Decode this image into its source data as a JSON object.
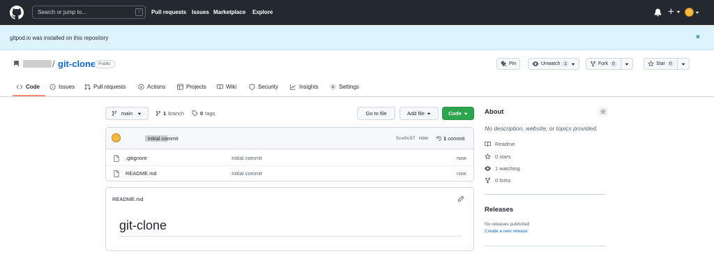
{
  "header": {
    "search_placeholder": "Search or jump to...",
    "search_key": "/",
    "nav": [
      "Pull requests",
      "Issues",
      "Marketplace",
      "Explore"
    ]
  },
  "banner": {
    "text": "gitpod.io was installed on this repository",
    "close": "×"
  },
  "repo": {
    "separator": "/",
    "name": "git-clone",
    "visibility": "Public",
    "pin_label": "Pin",
    "unwatch_label": "Unwatch",
    "unwatch_count": "1",
    "fork_label": "Fork",
    "fork_count": "0",
    "star_label": "Star",
    "star_count": "0"
  },
  "tabs": [
    "Code",
    "Issues",
    "Pull requests",
    "Actions",
    "Projects",
    "Wiki",
    "Security",
    "Insights",
    "Settings"
  ],
  "main": {
    "branch": "main",
    "branches_count": "1",
    "branches_label": "branch",
    "tags_count": "0",
    "tags_label": "tags",
    "goto_file": "Go to file",
    "add_file": "Add file",
    "code_button": "Code",
    "commit": {
      "message": "Initial commit",
      "sha": "5ce0c97",
      "time": "now",
      "count": "1",
      "count_label": "commit"
    },
    "files": [
      {
        "name": ".gitignore",
        "message": "Initial commit",
        "time": "now"
      },
      {
        "name": "README.md",
        "message": "Initial commit",
        "time": "now"
      }
    ],
    "readme": {
      "filename": "README.md",
      "heading": "git-clone"
    }
  },
  "sidebar": {
    "about_title": "About",
    "description": "No description, website, or topics provided.",
    "items": [
      "Readme",
      "0 stars",
      "1 watching",
      "0 forks"
    ],
    "releases_title": "Releases",
    "releases_text": "No releases published",
    "releases_link": "Create a new release"
  },
  "colors": {
    "header_bg": "#24292f",
    "banner_bg": "#ddf4ff",
    "link": "#0969da",
    "code_button": "#2da44e",
    "tab_underline": "#fd8c73"
  }
}
